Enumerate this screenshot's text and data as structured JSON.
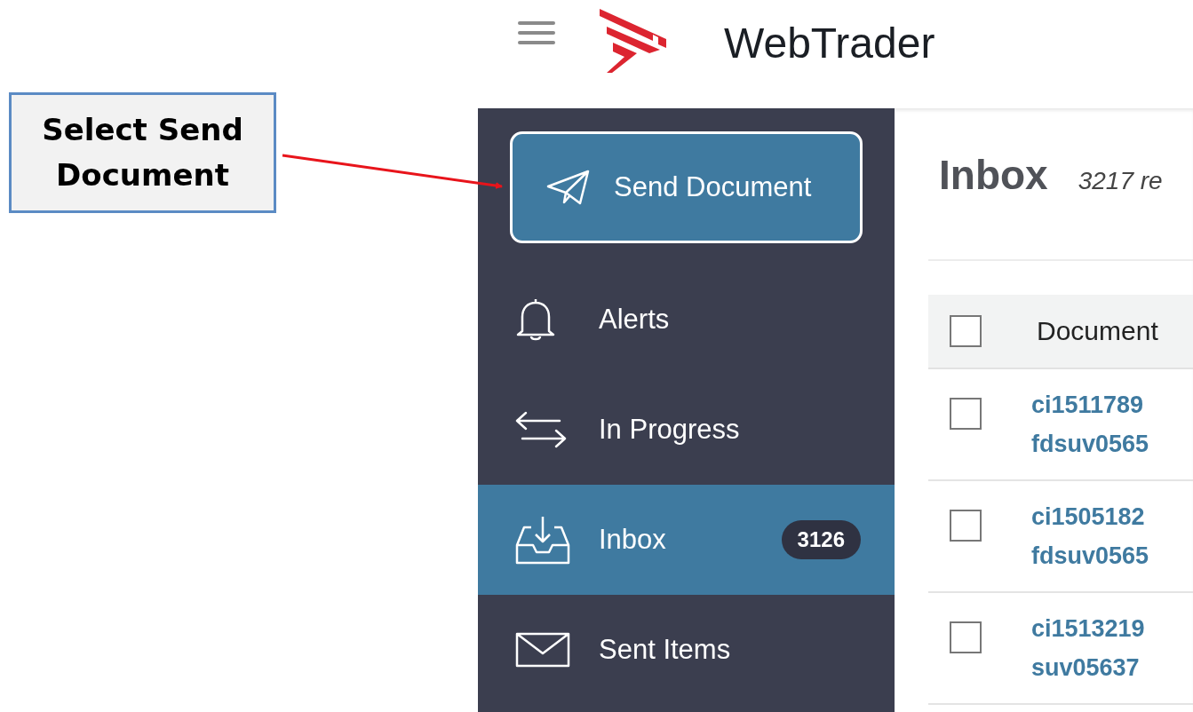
{
  "annotation": {
    "text": "Select Send Document"
  },
  "header": {
    "title": "WebTrader"
  },
  "sidebar": {
    "send_button": "Send Document",
    "items": [
      {
        "label": "Alerts",
        "kind": "alerts",
        "selected": false
      },
      {
        "label": "In Progress",
        "kind": "progress",
        "selected": false
      },
      {
        "label": "Inbox",
        "kind": "inbox",
        "badge": "3126",
        "selected": true
      },
      {
        "label": "Sent Items",
        "kind": "sent",
        "selected": false
      }
    ]
  },
  "content": {
    "title": "Inbox",
    "count": "3217 re",
    "table": {
      "header_checked": false,
      "columns": [
        "Document"
      ],
      "rows": [
        {
          "checked": false,
          "lines": [
            "ci1511789",
            "fdsuv0565"
          ]
        },
        {
          "checked": false,
          "lines": [
            "ci1505182",
            "fdsuv0565"
          ]
        },
        {
          "checked": false,
          "lines": [
            "ci1513219",
            "suv05637"
          ]
        }
      ]
    }
  }
}
